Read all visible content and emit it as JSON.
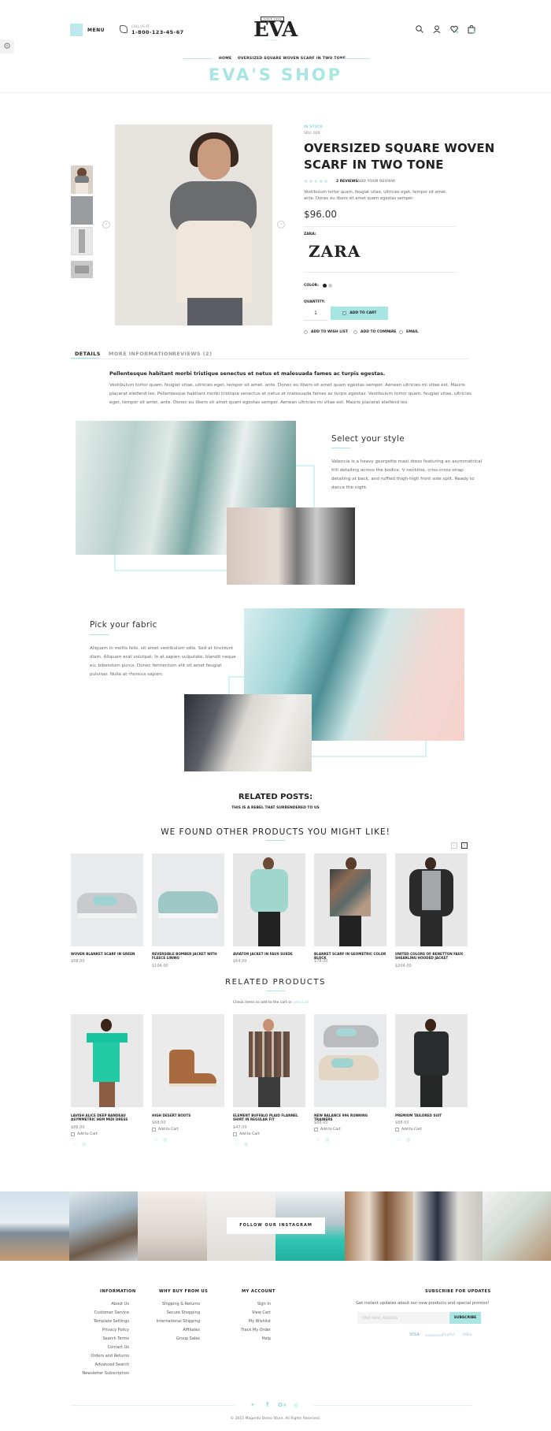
{
  "header": {
    "menu_label": "MENU",
    "phone_small": "CALL US AT",
    "phone_number": "1-800-123-45-67",
    "logo_tag": "SINCE 1990",
    "logo_word": "EVA",
    "logo_sub": "STORE",
    "breadcrumb_home": "HOME",
    "breadcrumb_current": "OVERSIZED SQUARE WOVEN SCARF IN TWO TONE",
    "shop_title": "EVA'S SHOP"
  },
  "product": {
    "in_stock": "IN STOCK",
    "sku": "SKU: 026",
    "title_line1": "OVERSIZED SQUARE WOVEN",
    "title_line2": "SCARF IN TWO TONE",
    "reviews": "2 REVIEWS",
    "add_review": "ADD YOUR REVIEW",
    "short_desc": "Vestibulum tortor quam, feugiat vitae, ultricies eget, tempor sit amet, ante. Donec eu libero sit amet quam egestas semper.",
    "price": "$96.00",
    "brand_label": "ZARA:",
    "brand_logo": "ZARA",
    "color_label": "COLOR:",
    "quantity_label": "QUANTITY:",
    "quantity_value": "1",
    "add_to_cart": "ADD TO CART",
    "wishlist": "ADD TO WISH LIST",
    "compare": "ADD TO COMPARE",
    "email": "EMAIL"
  },
  "tabs": [
    "DETAILS",
    "MORE INFORMATION",
    "REVIEWS (2)"
  ],
  "details": {
    "heading": "Pellentesque habitant morbi tristique senectus et netus et malesuada fames ac turpis egestas.",
    "l1": "Vestibulum tortor quam, feugiat vitae, ultricies eget, tempor sit amet, ante. Donec eu libero sit amet quam egestas semper. Aenean ultricies mi vitae est. Mauris",
    "l2": "placerat eleifend leo. Pellentesque habitant morbi tristique senectus et netus et malesuada fames ac turpis egestas. Vestibulum tortor quam, feugiat vitae, ultricies",
    "l3": "eget, tempor sit amet, ante. Donec eu libero sit amet quam egestas semper. Aenean ultricies mi vitae est. Mauris placerat eleifend leo."
  },
  "style_block": {
    "title": "Select your style",
    "l1": "Valencia is a heavy georgette maxi dress featuring an asymmetrical",
    "l2": "frill detailing across the bodice. V neckline, criss-cross strap",
    "l3": "detailing at back, and ruffled thigh-high front side split. Ready to",
    "l4": "dance the night."
  },
  "fabric_block": {
    "title": "Pick your fabric",
    "l1": "Aliquam in mollis felis, sit amet vestibulum odio. Sed at tincidunt",
    "l2": "diam. Aliquam erat volutpat. In at sapien vulputate, blandit neque",
    "l3": "eu, bibendum purus. Donec fermentum elit sit amet feugiat",
    "l4": "pulvinar. Nulla at rhoncus sapien."
  },
  "related_posts": {
    "title": "RELATED POSTS:",
    "subtitle": "THIS IS A REBEL THAT SURRENDERED TO US"
  },
  "might_like": {
    "title": "WE FOUND OTHER PRODUCTS YOU MIGHT LIKE!",
    "items": [
      {
        "name": "WOVEN BLANKET SCARF IN GREEN",
        "price": "$68.00"
      },
      {
        "name": "REVERSIBLE BOMBER JACKET WITH FLEECE LINING",
        "price": "$104.00"
      },
      {
        "name": "AVIATOR JACKET IN FAUX SUEDE",
        "price": "$64.00"
      },
      {
        "name": "BLANKET SCARF IN GEOMETRIC COLOR BLOCK",
        "price": "$78.00"
      },
      {
        "name": "UNITED COLORS OF BENETTON FAUX SHEARLING HOODED JACKET",
        "price": "$204.00"
      }
    ]
  },
  "related_products": {
    "title": "RELATED PRODUCTS",
    "note_prefix": "Check items to add to the cart or",
    "note_link": "select all",
    "add_label": "Add to Cart",
    "items": [
      {
        "name": "LAVISH ALICE DEEP BANDEAU ASYMMETRIC HEM MIDI DRESS",
        "price": "$88.00"
      },
      {
        "name": "HIGH DESERT BOOTS",
        "price": "$68.00"
      },
      {
        "name": "ELEMENT BUFFALO PLAID FLANNEL SHIRT IN REGULAR FIT",
        "price": "$47.00"
      },
      {
        "name": "NEW BALANCE 996 RUNNING TRAINERS",
        "price": "$88.00"
      },
      {
        "name": "PREMIUM TAILORED SUIT",
        "price": "$88.00"
      }
    ]
  },
  "instagram": {
    "button": "FOLLOW OUR INSTAGRAM"
  },
  "footer": {
    "information": {
      "title": "INFORMATION",
      "links": [
        "About Us",
        "Customer Service",
        "Template Settings",
        "Privacy Policy",
        "Search Terms",
        "Contact Us",
        "Orders and Returns",
        "Advanced Search",
        "Newsletter Subscription"
      ]
    },
    "why_buy": {
      "title": "WHY BUY FROM US",
      "links": [
        "Shipping & Returns",
        "Secure Shopping",
        "International Shipping",
        "Affiliates",
        "Group Sales"
      ]
    },
    "my_account": {
      "title": "MY ACCOUNT",
      "links": [
        "Sign In",
        "View Cart",
        "My Wishlist",
        "Track My Order",
        "Help"
      ]
    },
    "subscribe": {
      "title": "SUBSCRIBE FOR UPDATES",
      "text": "Get instant updates about our new products and special promos!",
      "placeholder": "YOUR EMAIL ADDRESS",
      "button": "SUBSCRIBE",
      "payments": [
        "VISA",
        "mastercard",
        "PayPal",
        "AMEX"
      ]
    },
    "copyright": "© 2015 Magento Demo Store. All Rights Reserved."
  },
  "colors": {
    "accent": "#a8e6e3",
    "text": "#222222"
  }
}
